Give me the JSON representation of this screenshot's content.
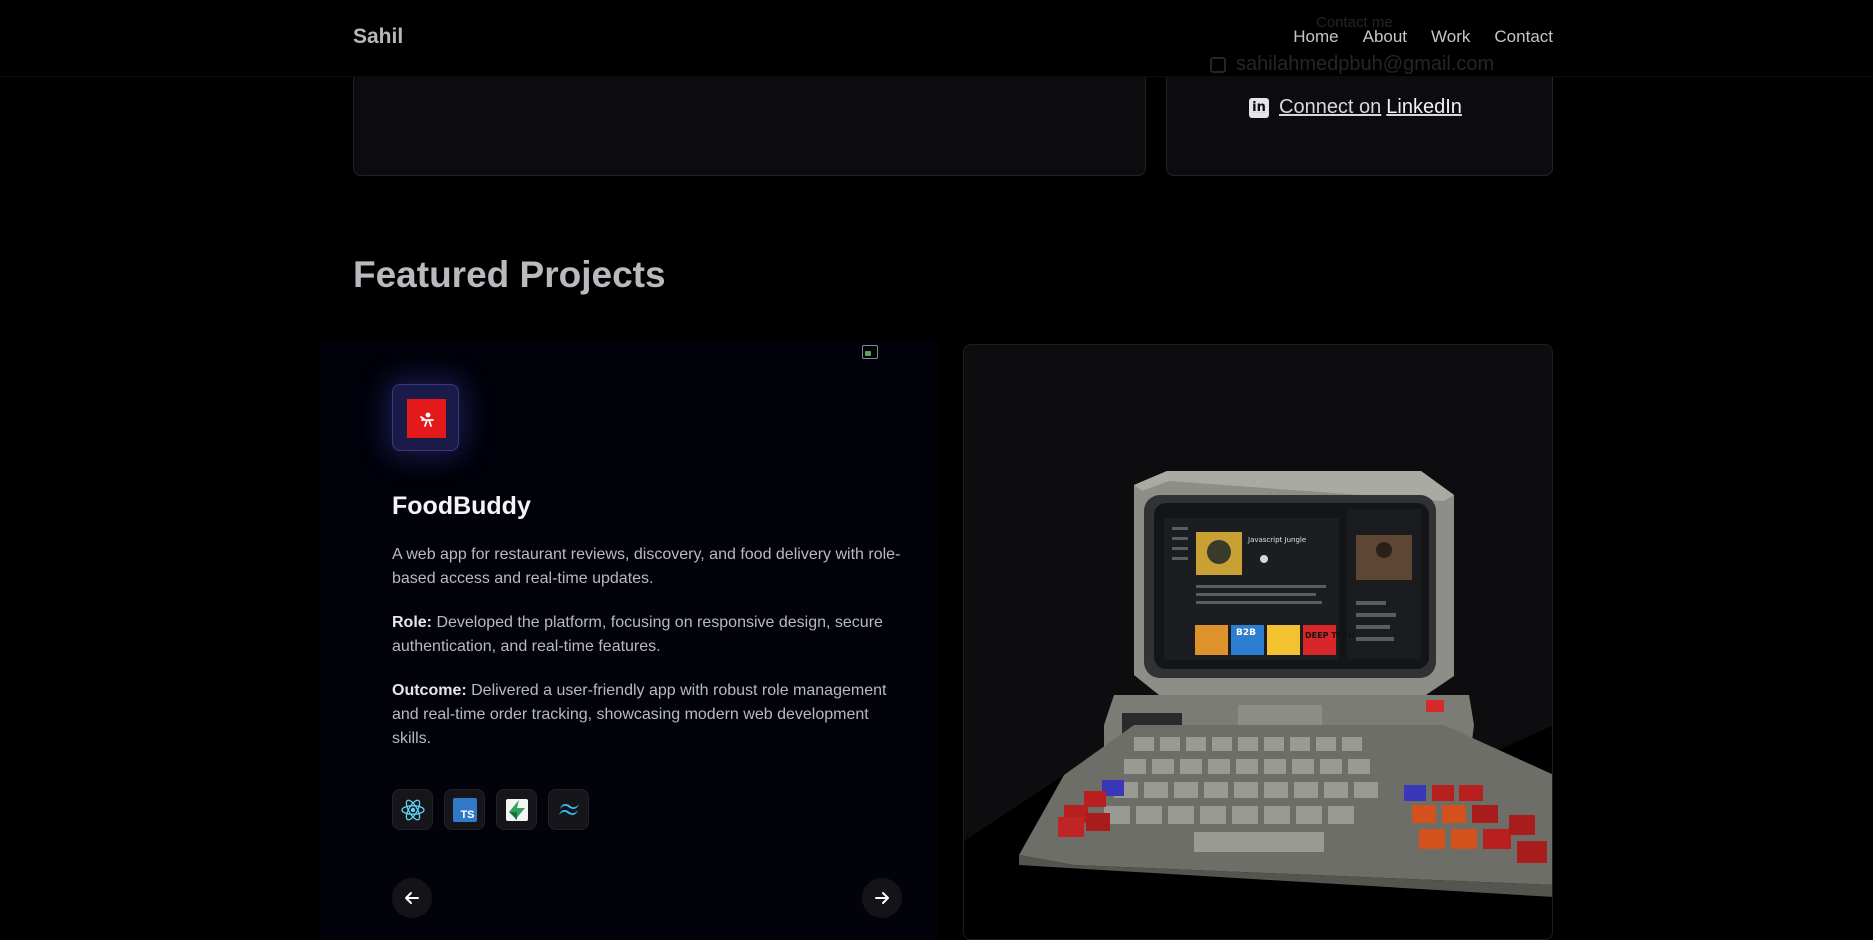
{
  "header": {
    "brand": "Sahil",
    "nav": [
      "Home",
      "About",
      "Work",
      "Contact"
    ]
  },
  "contact": {
    "heading": "Contact me",
    "email": "sahilahmedpbuh@gmail.com",
    "linkedin_prefix": "Connect on",
    "linkedin_name": "LinkedIn"
  },
  "section": {
    "title": "Featured Projects"
  },
  "project": {
    "title": "FoodBuddy",
    "description": "A web app for restaurant reviews, discovery, and food delivery with role-based access and real-time updates.",
    "role_label": "Role:",
    "role_text": " Developed the platform, focusing on responsive design, secure authentication, and real-time features.",
    "outcome_label": "Outcome:",
    "outcome_text": " Delivered a user-friendly app with robust role management and real-time order tracking, showcasing modern web development skills.",
    "tech": [
      "react-icon",
      "typescript-icon",
      "supabase-icon",
      "tailwind-icon"
    ],
    "ts_label": "TS"
  },
  "screen": {
    "app_name": "Javascript Jungle",
    "tiles": [
      "B2B",
      "DEEP TECH"
    ]
  },
  "colors": {
    "background": "#000000",
    "card": "#0c0c0e",
    "logo_red": "#e3191b",
    "logo_glow": "#3a3a7a"
  }
}
